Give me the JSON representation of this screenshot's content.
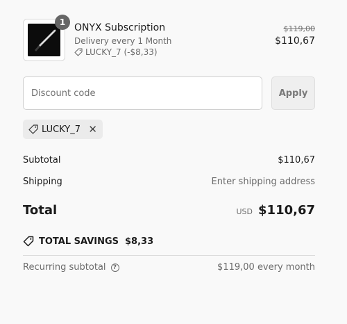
{
  "product": {
    "quantity": "1",
    "name": "ONYX Subscription",
    "delivery": "Delivery every 1 Month",
    "discount_applied": "LUCKY_7 (-$8,33)",
    "price_original": "$119,00",
    "price_current": "$110,67",
    "image_icon": "knife-product-image"
  },
  "discount": {
    "placeholder": "Discount code",
    "apply_label": "Apply",
    "applied_code": "LUCKY_7"
  },
  "summary": {
    "subtotal_label": "Subtotal",
    "subtotal_value": "$110,67",
    "shipping_label": "Shipping",
    "shipping_value": "Enter shipping address",
    "total_label": "Total",
    "currency": "USD",
    "total_value": "$110,67",
    "savings_label": "TOTAL SAVINGS",
    "savings_value": "$8,33",
    "recurring_label": "Recurring subtotal",
    "recurring_value": "$119,00 every month"
  },
  "colors": {
    "background": "#f9f9f9",
    "badge": "#666666",
    "chip": "#ebebeb"
  }
}
